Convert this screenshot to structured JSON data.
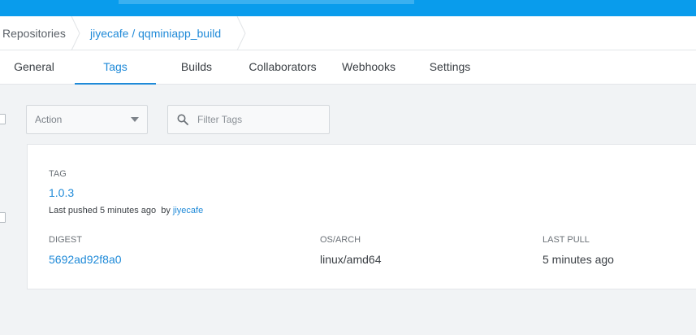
{
  "breadcrumb": {
    "root": "Repositories",
    "current": "jiyecafe / qqminiapp_build"
  },
  "tabs": [
    {
      "label": "General"
    },
    {
      "label": "Tags"
    },
    {
      "label": "Builds"
    },
    {
      "label": "Collaborators"
    },
    {
      "label": "Webhooks"
    },
    {
      "label": "Settings"
    }
  ],
  "active_tab": "Tags",
  "toolbar": {
    "action_label": "Action",
    "filter_placeholder": "Filter Tags",
    "filter_value": ""
  },
  "tag_card": {
    "tag_header": "TAG",
    "tag_name": "1.0.3",
    "last_pushed_prefix": "Last pushed",
    "last_pushed_time": "5 minutes ago",
    "by_prefix": "by",
    "pushed_by": "jiyecafe",
    "digest_header": "DIGEST",
    "digest": "5692ad92f8a0",
    "osarch_header": "OS/ARCH",
    "osarch": "linux/amd64",
    "last_pull_header": "LAST PULL",
    "last_pull": "5 minutes ago"
  },
  "colors": {
    "topbar": "#099cec",
    "accent": "#1f8ad8",
    "background": "#f1f3f5"
  },
  "icons": [
    "search-icon",
    "chevron-down-icon",
    "chevron-right-icon"
  ]
}
